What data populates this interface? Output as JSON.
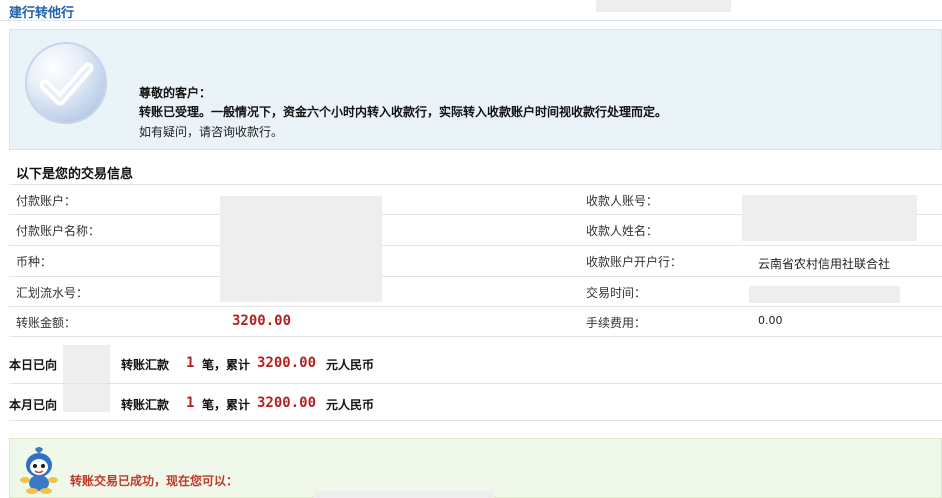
{
  "page": {
    "title": "建行转他行"
  },
  "notice": {
    "greeting": "尊敬的客户：",
    "main": "转账已受理。一般情况下，资金六个小时内转入收款行，实际转入收款账户时间视收款行处理而定。",
    "sub": "如有疑问，请咨询收款行。"
  },
  "details": {
    "title": "以下是您的交易信息",
    "payer_account_label": "付款账户：",
    "payer_name_label": "付款账户名称：",
    "currency_label": "币种：",
    "serial_label": "汇划流水号：",
    "amount_label": "转账金额：",
    "amount_value": "3200.00",
    "payee_account_label": "收款人账号：",
    "payee_name_label": "收款人姓名：",
    "payee_bank_label": "收款账户开户行：",
    "payee_bank_value": "云南省农村信用社联合社",
    "time_label": "交易时间：",
    "fee_label": "手续费用：",
    "fee_value": "0.00"
  },
  "summary": {
    "today_prefix": "本日已向",
    "month_prefix": "本月已向",
    "transfer_label": "转账汇款",
    "count": "1",
    "count_unit": "笔，累计",
    "amount": "3200.00",
    "currency_unit": "元人民币"
  },
  "result": {
    "success_text": "转账交易已成功，现在您可以："
  },
  "icons": {
    "check": "check-circle-icon",
    "mascot": "mascot-icon"
  },
  "colors": {
    "title_blue": "#1f5fa6",
    "amount_red": "#b22222",
    "notice_bg": "#eaf4f8",
    "success_bg": "#f0f8ea"
  }
}
